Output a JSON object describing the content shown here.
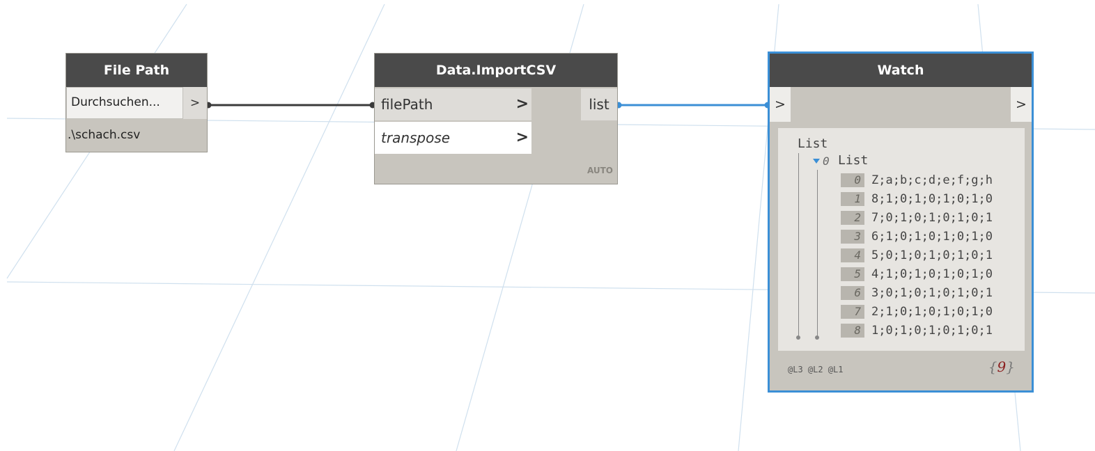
{
  "nodes": {
    "file_path": {
      "title": "File Path",
      "browse_label": "Durchsuchen...",
      "output_label": ">",
      "value": ".\\schach.csv"
    },
    "import_csv": {
      "title": "Data.ImportCSV",
      "inputs": [
        {
          "label": "filePath",
          "arrow": ">"
        },
        {
          "label": "transpose",
          "arrow": ">"
        }
      ],
      "output_label": "list",
      "lacing": "AUTO"
    },
    "watch": {
      "title": "Watch",
      "input_label": ">",
      "output_label": ">",
      "root_label": "List",
      "sublist_index": "0",
      "sublist_label": "List",
      "items": [
        {
          "index": "0",
          "value": "Z;a;b;c;d;e;f;g;h"
        },
        {
          "index": "1",
          "value": "8;1;0;1;0;1;0;1;0"
        },
        {
          "index": "2",
          "value": "7;0;1;0;1;0;1;0;1"
        },
        {
          "index": "3",
          "value": "6;1;0;1;0;1;0;1;0"
        },
        {
          "index": "4",
          "value": "5;0;1;0;1;0;1;0;1"
        },
        {
          "index": "5",
          "value": "4;1;0;1;0;1;0;1;0"
        },
        {
          "index": "6",
          "value": "3;0;1;0;1;0;1;0;1"
        },
        {
          "index": "7",
          "value": "2;1;0;1;0;1;0;1;0"
        },
        {
          "index": "8",
          "value": "1;0;1;0;1;0;1;0;1"
        }
      ],
      "levels": "@L3 @L2 @L1",
      "count_open": "{",
      "count": "9",
      "count_close": "}"
    }
  },
  "colors": {
    "header": "#4a4a4a",
    "node_body": "#c8c5be",
    "selected_border": "#3b8fd6",
    "wire_default": "#3a3a3a",
    "wire_active": "#3b8fd6",
    "grid": "#cfe0ee"
  }
}
